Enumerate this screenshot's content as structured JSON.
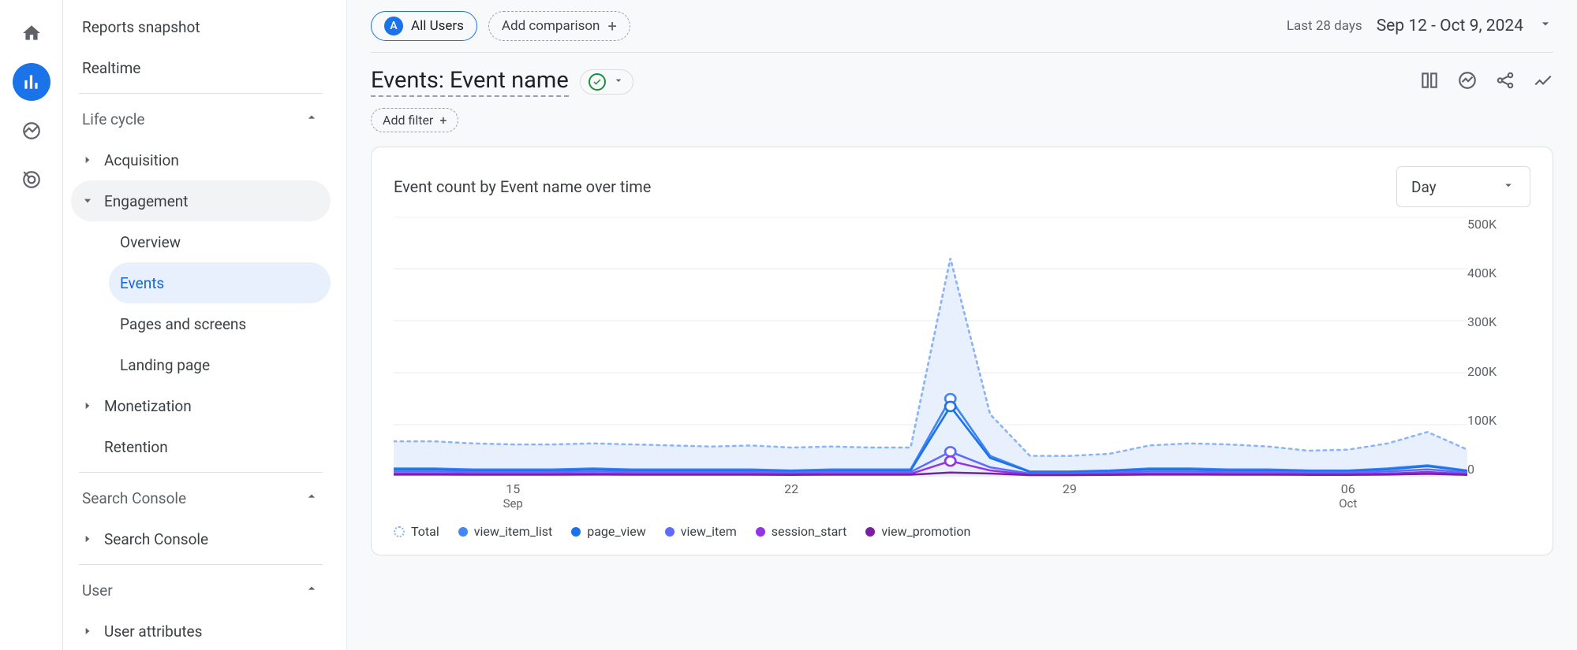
{
  "rail": {
    "active_index": 1
  },
  "sidebar": {
    "items_top": [
      {
        "label": "Reports snapshot"
      },
      {
        "label": "Realtime"
      }
    ],
    "section_life_cycle": "Life cycle",
    "acquisition": "Acquisition",
    "engagement": "Engagement",
    "engagement_children": [
      {
        "label": "Overview"
      },
      {
        "label": "Events"
      },
      {
        "label": "Pages and screens"
      },
      {
        "label": "Landing page"
      }
    ],
    "monetization": "Monetization",
    "retention": "Retention",
    "section_search_console": "Search Console",
    "search_console": "Search Console",
    "section_user": "User",
    "user_attributes": "User attributes"
  },
  "header": {
    "chip_all_users_badge": "A",
    "chip_all_users": "All Users",
    "chip_add_comparison": "Add comparison",
    "date_label": "Last 28 days",
    "date_range": "Sep 12 - Oct 9, 2024"
  },
  "page": {
    "title": "Events: Event name",
    "add_filter": "Add filter"
  },
  "card": {
    "title": "Event count by Event name over time",
    "granularity": "Day"
  },
  "chart_data": {
    "type": "line",
    "ylabel": "",
    "ylim": [
      0,
      500000
    ],
    "yticks": [
      "0",
      "100K",
      "200K",
      "300K",
      "400K",
      "500K"
    ],
    "x_dates": [
      "Sep 12",
      "Sep 13",
      "Sep 14",
      "Sep 15",
      "Sep 16",
      "Sep 17",
      "Sep 18",
      "Sep 19",
      "Sep 20",
      "Sep 21",
      "Sep 22",
      "Sep 23",
      "Sep 24",
      "Sep 25",
      "Sep 26",
      "Sep 27",
      "Sep 28",
      "Sep 29",
      "Sep 30",
      "Oct 1",
      "Oct 2",
      "Oct 3",
      "Oct 4",
      "Oct 5",
      "Oct 6",
      "Oct 7",
      "Oct 8",
      "Oct 9"
    ],
    "xticks": [
      {
        "pos": 3,
        "label": "15",
        "sub": "Sep"
      },
      {
        "pos": 10,
        "label": "22",
        "sub": ""
      },
      {
        "pos": 17,
        "label": "29",
        "sub": ""
      },
      {
        "pos": 24,
        "label": "06",
        "sub": "Oct"
      }
    ],
    "series": [
      {
        "name": "Total",
        "color": "#8ab4f8",
        "style": "dashed-area",
        "values": [
          68000,
          68000,
          64000,
          62000,
          62000,
          64000,
          62000,
          60000,
          58000,
          60000,
          56000,
          58000,
          56000,
          56000,
          420000,
          120000,
          40000,
          40000,
          44000,
          60000,
          64000,
          62000,
          58000,
          50000,
          52000,
          64000,
          86000,
          52000
        ]
      },
      {
        "name": "view_item_list",
        "color": "#4285f4",
        "values": [
          16000,
          16000,
          14000,
          14000,
          14000,
          16000,
          14000,
          14000,
          14000,
          14000,
          12000,
          14000,
          14000,
          14000,
          150000,
          40000,
          10000,
          10000,
          12000,
          16000,
          16000,
          14000,
          14000,
          12000,
          12000,
          16000,
          22000,
          12000
        ]
      },
      {
        "name": "page_view",
        "color": "#1a73e8",
        "values": [
          14000,
          14000,
          12000,
          12000,
          12000,
          14000,
          12000,
          12000,
          12000,
          12000,
          11000,
          12000,
          12000,
          12000,
          135000,
          36000,
          9000,
          9000,
          11000,
          14000,
          14000,
          12000,
          12000,
          11000,
          11000,
          14000,
          20000,
          11000
        ]
      },
      {
        "name": "view_item",
        "color": "#5e6bff",
        "values": [
          10000,
          10000,
          9000,
          9000,
          9000,
          10000,
          9000,
          9000,
          9000,
          9000,
          8000,
          9000,
          9000,
          9000,
          48000,
          18000,
          6000,
          6000,
          8000,
          10000,
          10000,
          9000,
          9000,
          8000,
          8000,
          10000,
          14000,
          8000
        ]
      },
      {
        "name": "session_start",
        "color": "#9334e6",
        "values": [
          6000,
          6000,
          5500,
          5500,
          5500,
          6000,
          5500,
          5500,
          5500,
          5500,
          5000,
          5500,
          5500,
          5500,
          30000,
          12000,
          4000,
          4000,
          5000,
          6000,
          6000,
          5500,
          5500,
          5000,
          5000,
          6000,
          9000,
          5000
        ]
      },
      {
        "name": "view_promotion",
        "color": "#7b1fa2",
        "values": [
          4000,
          4000,
          3800,
          3800,
          3800,
          4000,
          3800,
          3800,
          3800,
          3800,
          3500,
          3800,
          3800,
          3800,
          8000,
          6000,
          3000,
          3000,
          3500,
          4000,
          4000,
          3800,
          3800,
          3500,
          3500,
          4000,
          5500,
          3500
        ]
      }
    ]
  }
}
